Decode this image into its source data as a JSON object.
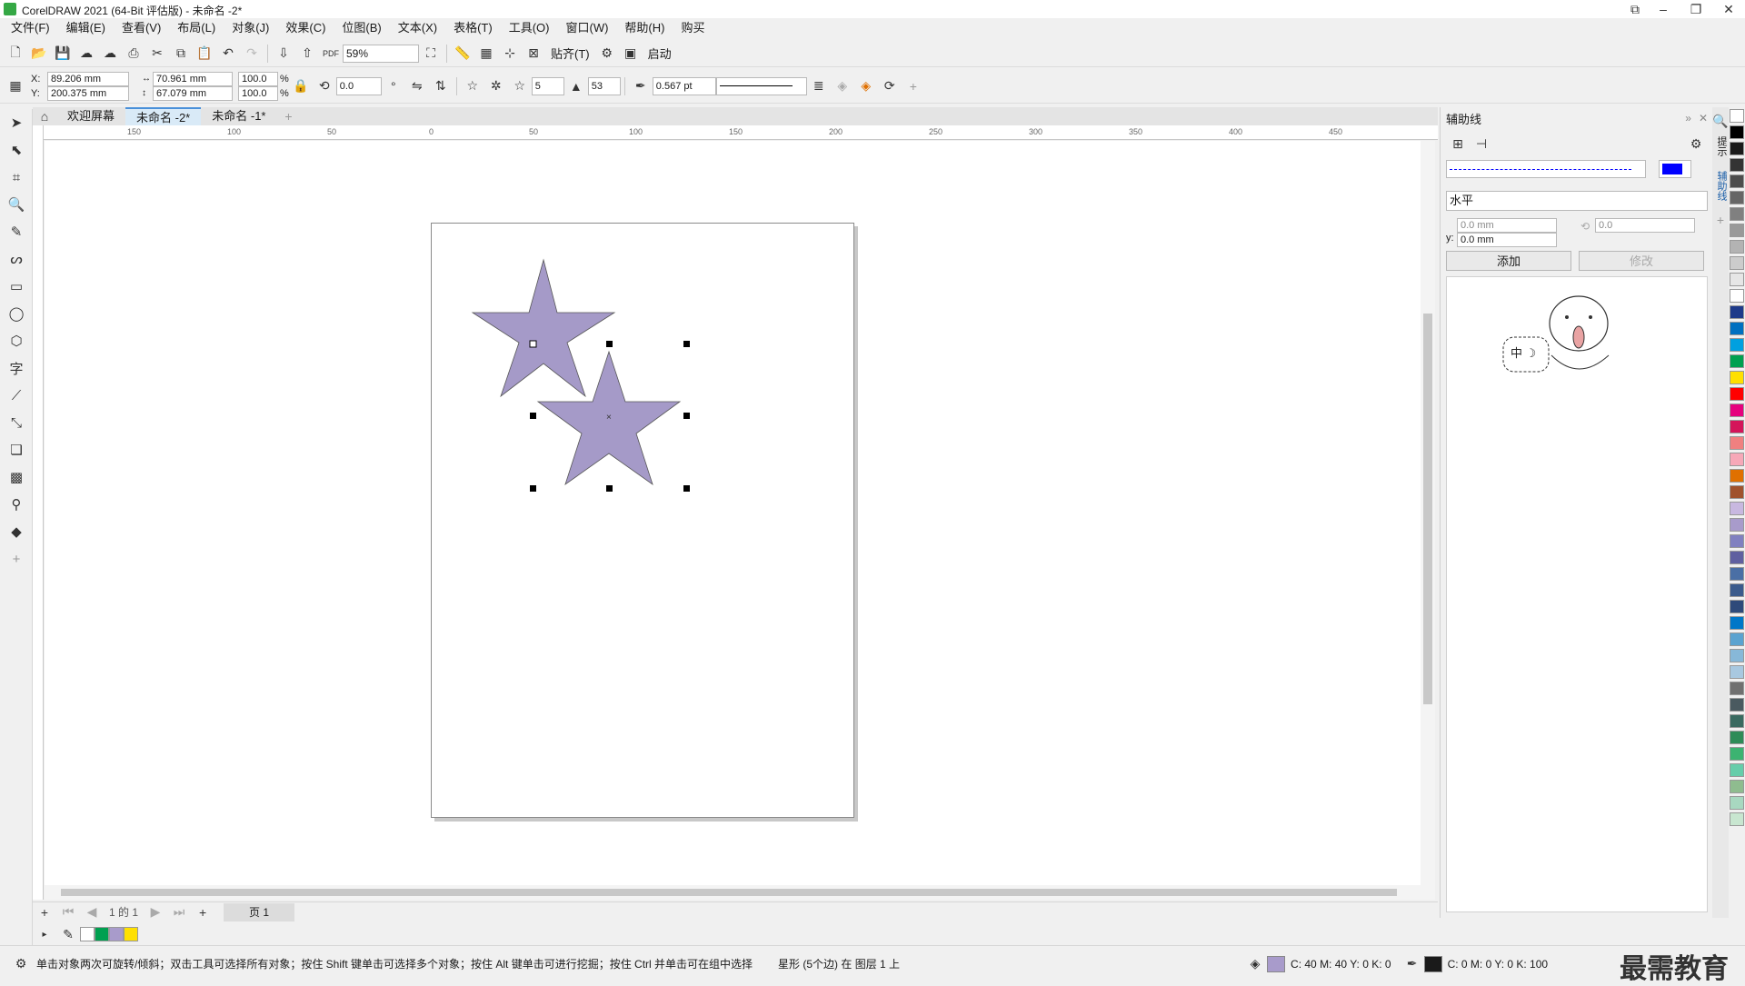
{
  "window": {
    "title": "CorelDRAW 2021 (64-Bit 评估版) - 未命名 -2*"
  },
  "menu": [
    "文件(F)",
    "编辑(E)",
    "查看(V)",
    "布局(L)",
    "对象(J)",
    "效果(C)",
    "位图(B)",
    "文本(X)",
    "表格(T)",
    "工具(O)",
    "窗口(W)",
    "帮助(H)",
    "购买"
  ],
  "toolbar1": {
    "zoom": "59%",
    "snap_label": "贴齐(T)",
    "launch_label": "启动"
  },
  "property_bar": {
    "x": "89.206 mm",
    "y": "200.375 mm",
    "x_label": "X:",
    "y_label": "Y:",
    "width": "70.961 mm",
    "height": "67.079 mm",
    "scale_w": "100.0",
    "scale_h": "100.0",
    "pct": "%",
    "angle": "0.0",
    "points": "5",
    "sharpness": "53",
    "outline_width": "0.567 pt"
  },
  "tabs": [
    "欢迎屏幕",
    "未命名 -2*",
    "未命名 -1*"
  ],
  "active_tab": 1,
  "ruler_h": [
    "150",
    "100",
    "50",
    "0",
    "50",
    "100",
    "150",
    "200",
    "250",
    "300",
    "350",
    "400",
    "450"
  ],
  "page_nav": {
    "page_of": "1 的 1",
    "page_tab": "页 1"
  },
  "docker": {
    "title": "辅助线",
    "orientation": "水平",
    "x_value": "0.0 mm",
    "y_value": "0.0 mm",
    "y_label": "y:",
    "angle_value": "0.0",
    "add_label": "添加",
    "modify_label": "修改",
    "mascot_text": "中 ☽",
    "line_color": "#0000ff"
  },
  "docker_tabs": [
    "提示",
    "辅助线"
  ],
  "status": {
    "hint": "单击对象两次可旋转/倾斜；双击工具可选择所有对象；按住 Shift 键单击可选择多个对象；按住 Alt 键单击可进行挖掘；按住 Ctrl 并单击可在组中选择",
    "object_info": "星形 (5个边) 在 图层 1 上",
    "fill_info": "C: 40 M: 40 Y: 0 K: 0",
    "outline_info": "C: 0 M: 0 Y: 0 K: 100",
    "fill_color": "#a89bcb",
    "outline_color": "#1a1a1a",
    "watermark": "最需教育"
  },
  "star_color": "#a59ac8",
  "palette": [
    "#ffffff",
    "#000000",
    "#1a1a1a",
    "#333333",
    "#4d4d4d",
    "#666666",
    "#808080",
    "#999999",
    "#b3b3b3",
    "#cccccc",
    "#e6e6e6",
    "#ffffff",
    "#1e3a8a",
    "#0070c0",
    "#00a0e0",
    "#00a050",
    "#ffe000",
    "#ff0000",
    "#e6007e",
    "#d4145a",
    "#f08080",
    "#f7a8b8",
    "#e07000",
    "#a0522d",
    "#c8b8e0",
    "#a89bcb",
    "#8080c0",
    "#6060a0",
    "#4a6fa5",
    "#3b5b8c",
    "#2e4a7a",
    "#0077c8",
    "#5ba3d0",
    "#87b8d8",
    "#a8c8e0",
    "#707070",
    "#4a5a60",
    "#3a6a60",
    "#2e8b57",
    "#3cb371",
    "#66cdaa",
    "#8fbc8f",
    "#a8d8c0",
    "#c8e6d0"
  ],
  "swatches_bottom": [
    "#ffffff",
    "#00a050",
    "#a89bcb",
    "#ffe000"
  ]
}
